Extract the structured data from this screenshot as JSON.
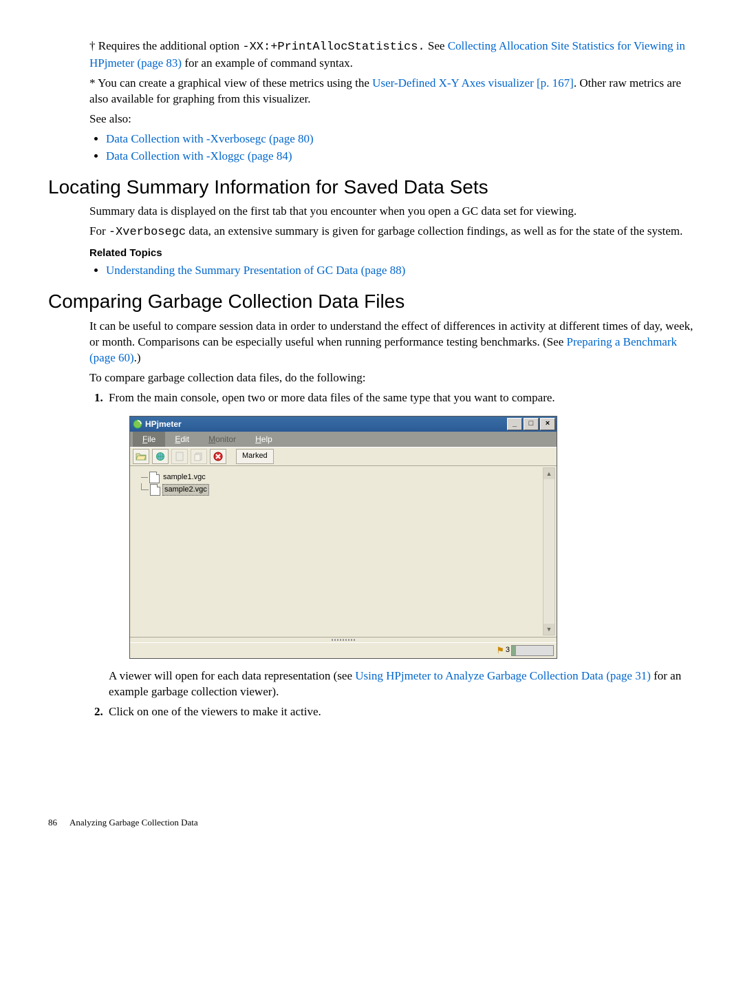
{
  "intro": {
    "dagger_prefix": "† Requires the additional option ",
    "dagger_code": "-XX:+PrintAllocStatistics.",
    "dagger_see": " See ",
    "dagger_link": "Collecting Allocation Site Statistics for Viewing in HPjmeter (page 83)",
    "dagger_tail": " for an example of command syntax.",
    "star_prefix": "* You can create a graphical view of these metrics using the ",
    "star_link": "User-Defined X-Y Axes visualizer [p. 167]",
    "star_tail": ". Other raw metrics are also available for graphing from this visualizer.",
    "see_also": "See also:",
    "bullets": {
      "b1": "Data Collection with -Xverbosegc (page 80)",
      "b2": "Data Collection with -Xloggc (page 84)"
    }
  },
  "sec1": {
    "title": "Locating Summary Information for Saved Data Sets",
    "p1": "Summary data is displayed on the first tab that you encounter when you open a GC data set for viewing.",
    "p2a": "For ",
    "p2code": "-Xverbosegc",
    "p2b": " data, an extensive summary is given for garbage collection findings, as well as for the state of the system.",
    "related": "Related Topics",
    "rel1": "Understanding the Summary Presentation of GC Data (page 88)"
  },
  "sec2": {
    "title": "Comparing Garbage Collection Data Files",
    "p1a": "It can be useful to compare session data in order to understand the effect of differences in activity at different times of day, week, or month. Comparisons can be especially useful when running performance testing benchmarks. (See ",
    "p1link": "Preparing a Benchmark (page 60)",
    "p1b": ".)",
    "p2": "To compare garbage collection data files, do the following:",
    "step1": "From the main console, open two or more data files of the same type that you want to compare.",
    "step1_tail_a": "A viewer will open for each data representation (see ",
    "step1_tail_link": "Using HPjmeter to Analyze Garbage Collection Data (page 31)",
    "step1_tail_b": " for an example garbage collection viewer).",
    "step2": "Click on one of the viewers to make it active."
  },
  "app": {
    "title": "HPjmeter",
    "menu": {
      "file": "File",
      "edit": "Edit",
      "monitor": "Monitor",
      "help": "Help"
    },
    "toolbar": {
      "marked": "Marked"
    },
    "tree": {
      "f1": "sample1.vgc",
      "f2": "sample2.vgc"
    },
    "status": {
      "count": "3"
    }
  },
  "footer": {
    "page": "86",
    "section": "Analyzing Garbage Collection Data"
  }
}
